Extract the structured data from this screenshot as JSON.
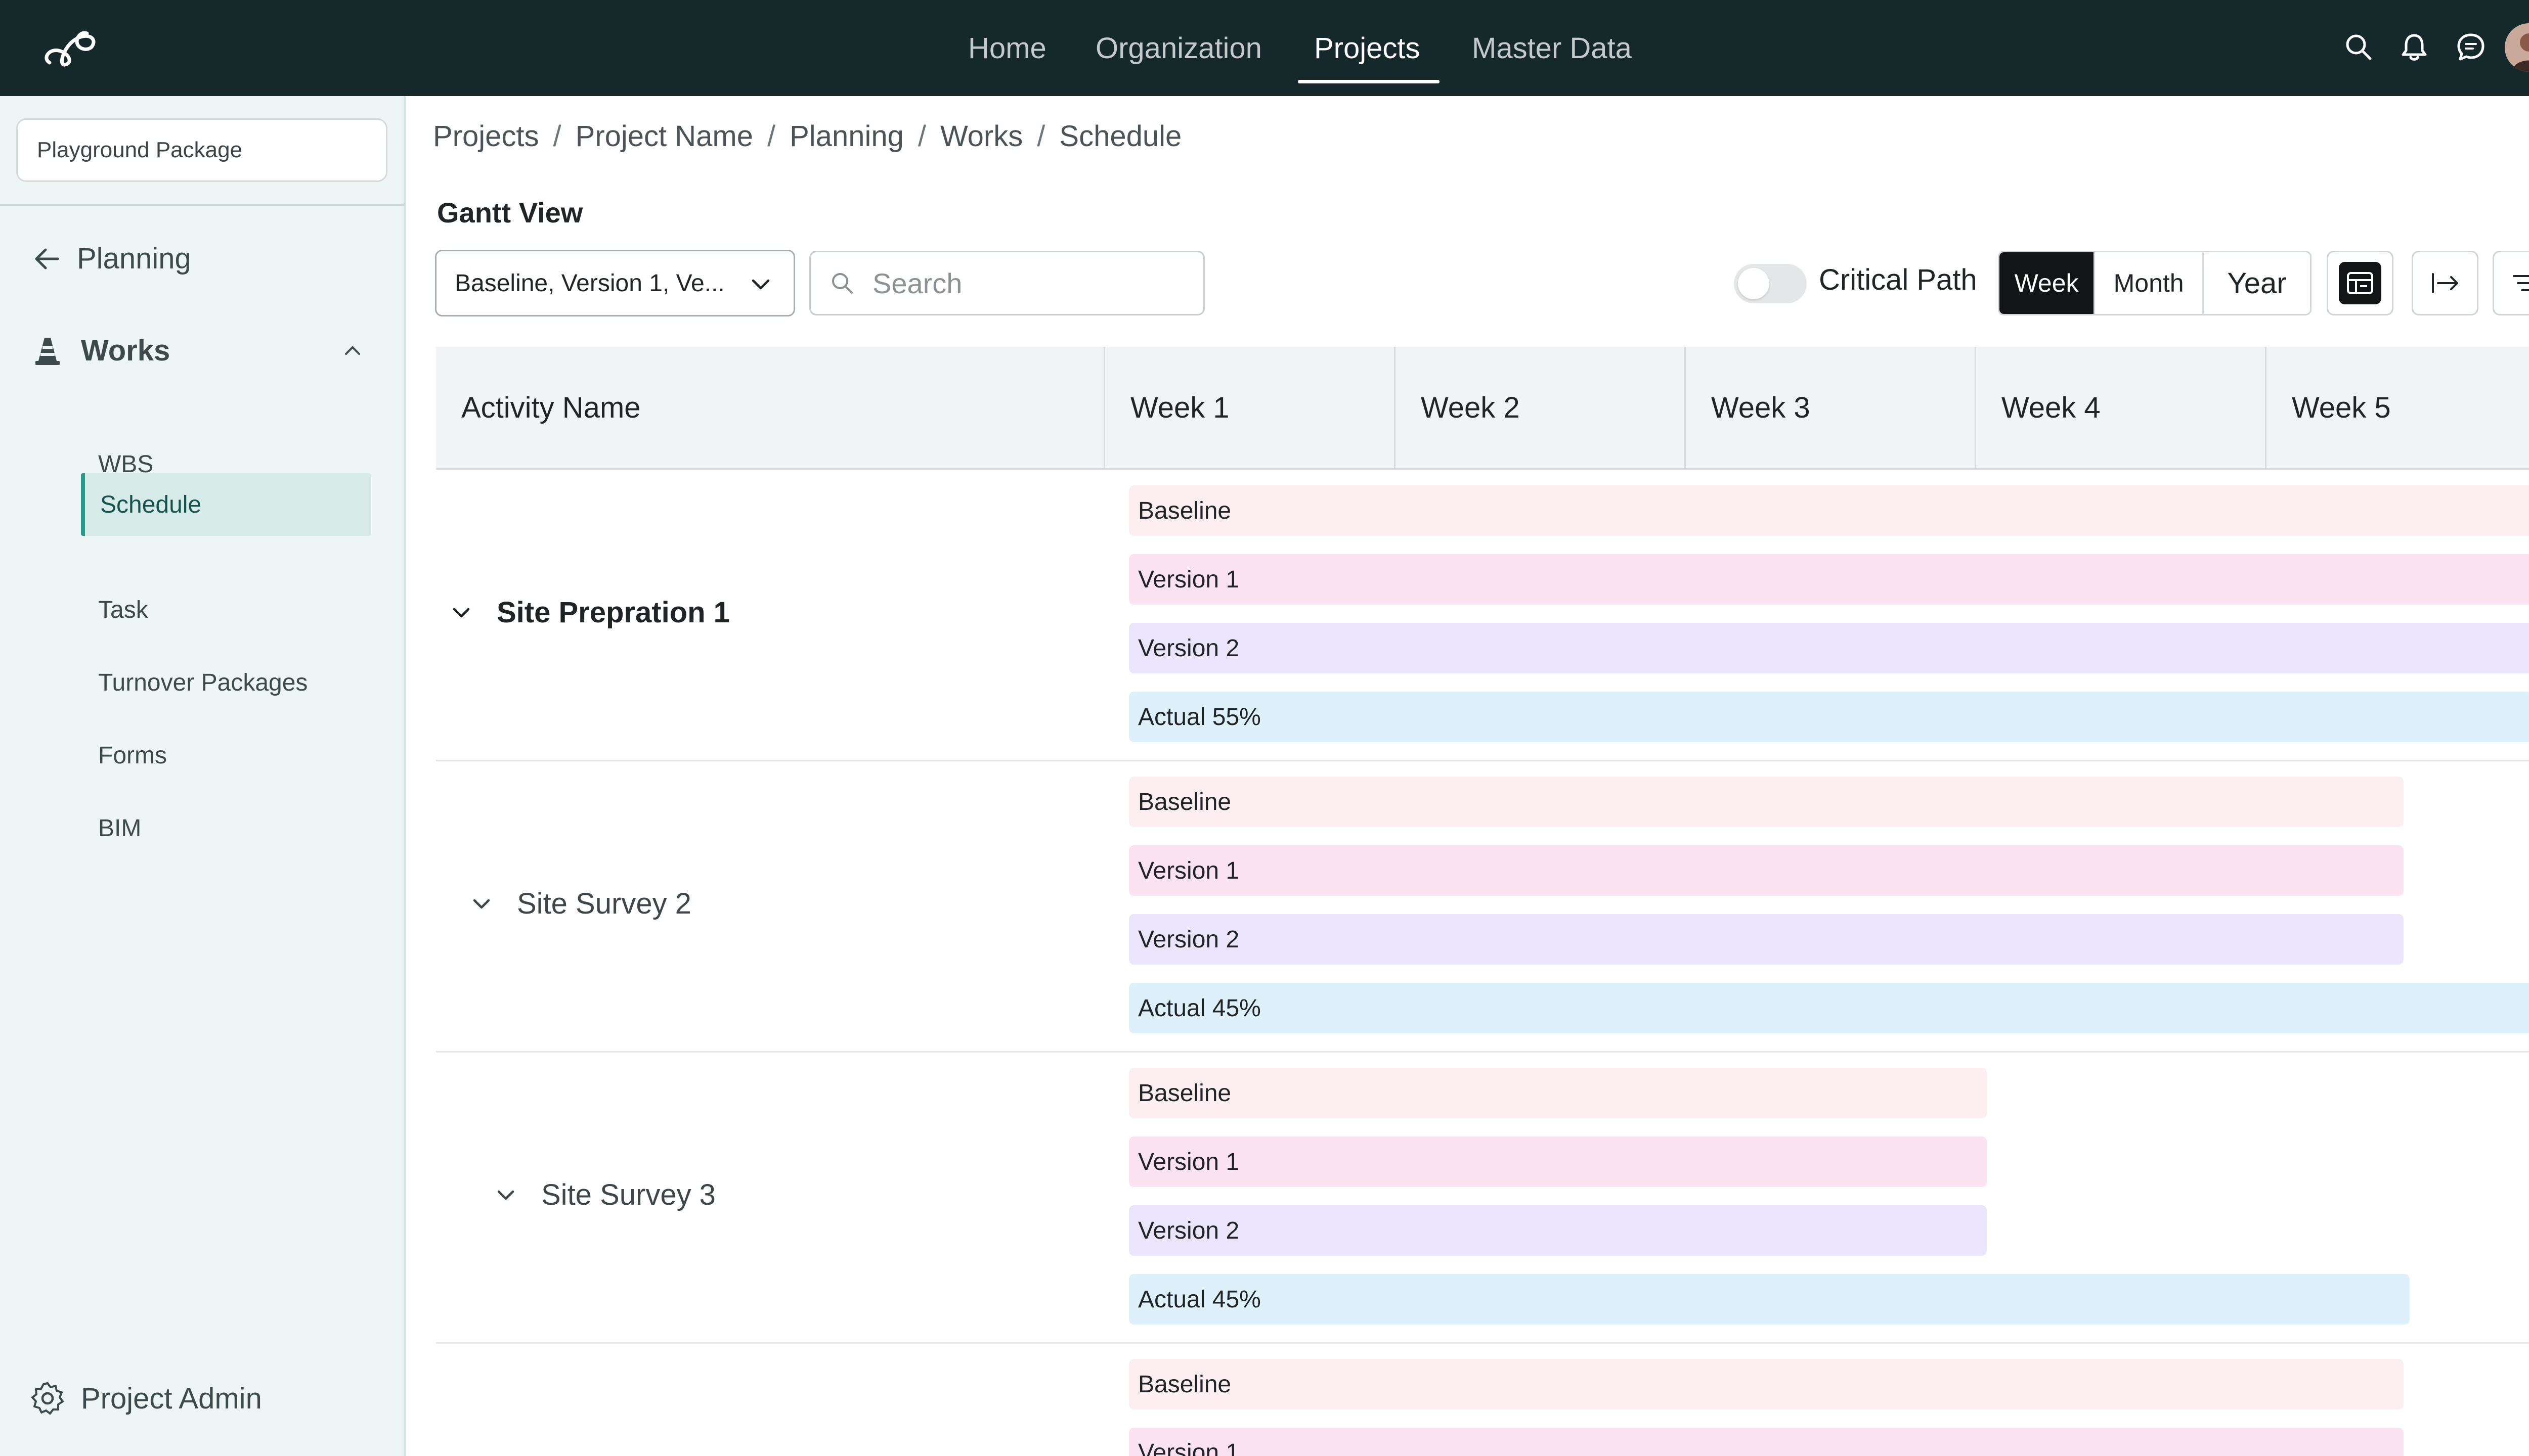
{
  "nav": {
    "items": [
      "Home",
      "Organization",
      "Projects",
      "Master Data"
    ],
    "active": "Projects"
  },
  "sidebar": {
    "package": "Playground Package",
    "back_label": "Planning",
    "section_label": "Works",
    "items": [
      "WBS",
      "Schedule",
      "Task",
      "Turnover Packages",
      "Forms",
      "BIM"
    ],
    "active_item": "Schedule",
    "footer_label": "Project Admin"
  },
  "breadcrumb": [
    "Projects",
    "Project Name",
    "Planning",
    "Works",
    "Schedule"
  ],
  "gantt": {
    "title": "Gantt View",
    "version_select_value": "Baseline, Version 1, Ve...",
    "search_placeholder": "Search",
    "critical_path_label": "Critical Path",
    "critical_path_on": false,
    "scale_options": [
      "Week",
      "Month",
      "Year"
    ],
    "active_scale": "Week",
    "columns": [
      "Activity Name",
      "Week 1",
      "Week 2",
      "Week 3",
      "Week 4",
      "Week 5"
    ],
    "activities": [
      {
        "name": "Site Prepration 1",
        "bars": [
          "Baseline",
          "Version 1",
          "Version 2",
          "Actual  55%"
        ]
      },
      {
        "name": "Site Survey 2",
        "bars": [
          "Baseline",
          "Version 1",
          "Version 2",
          "Actual  45%"
        ]
      },
      {
        "name": "Site Survey 3",
        "bars": [
          "Baseline",
          "Version 1",
          "Version 2",
          "Actual  45%"
        ]
      },
      {
        "name": "",
        "bars": [
          "Baseline",
          "Version 1"
        ]
      }
    ]
  },
  "colors": {
    "topbar": "#15282a",
    "sidebar_bg": "#edf6f5",
    "accent": "#2a9a8a",
    "baseline_bar": "#fdeef1",
    "version1_bar": "#fbe3f2",
    "version2_bar": "#ebe5fb",
    "actual_bar": "#def1fb"
  }
}
